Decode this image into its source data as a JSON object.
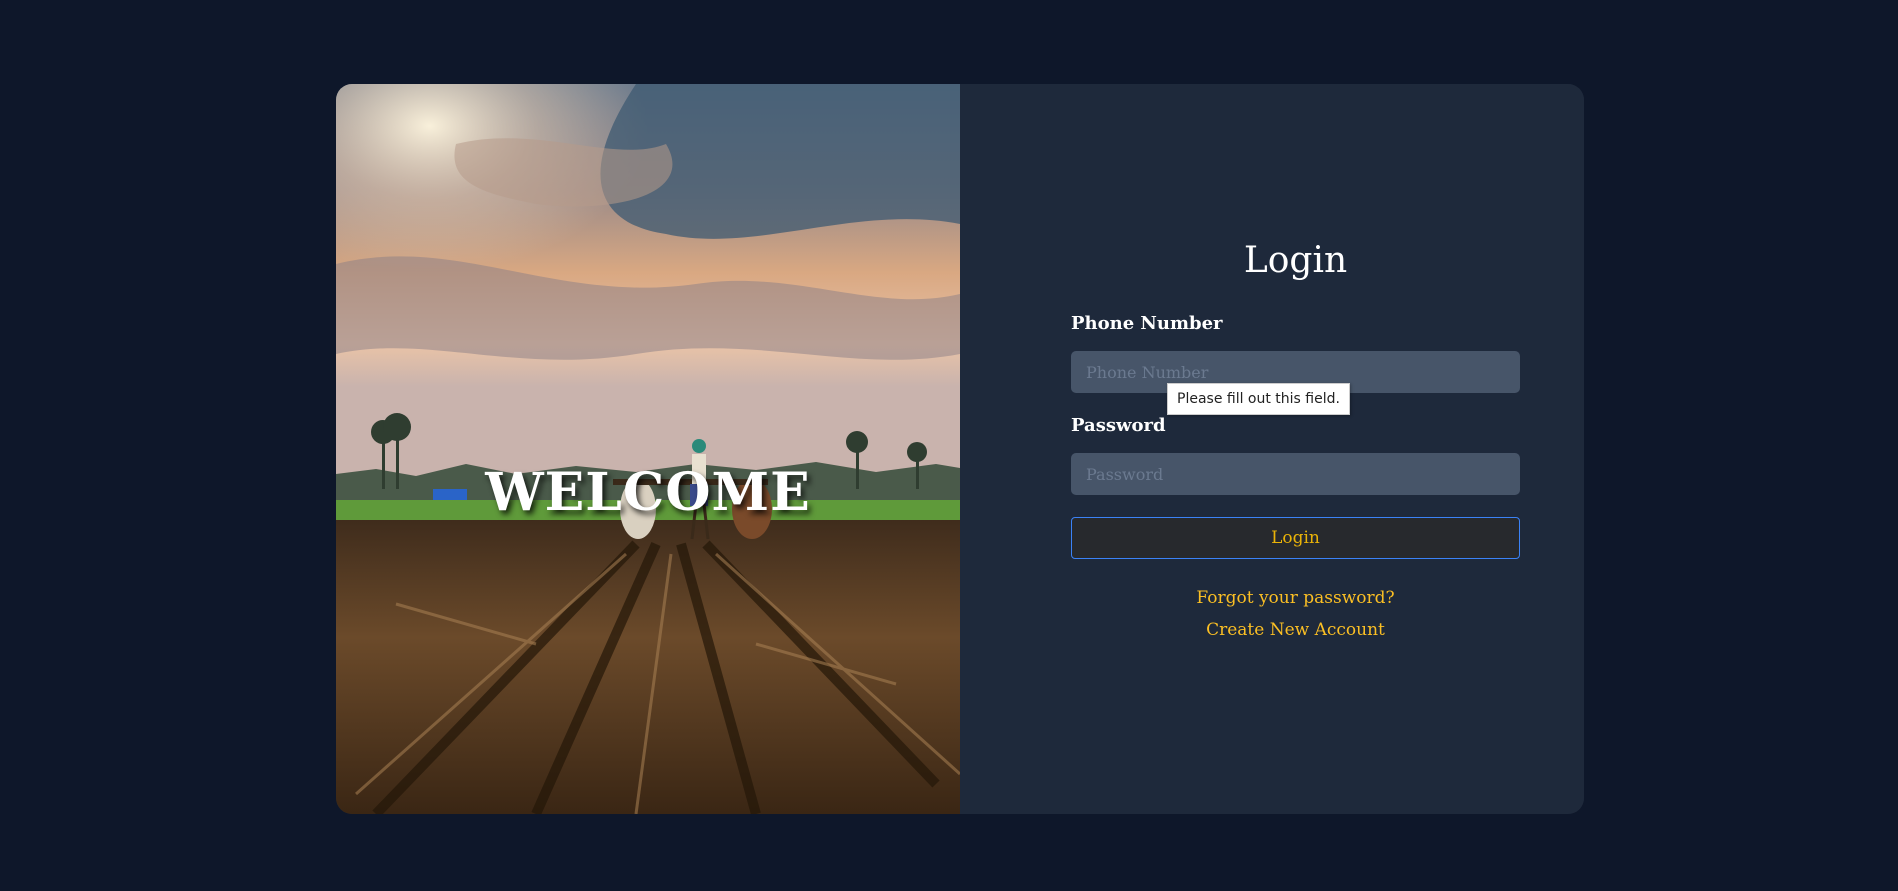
{
  "hero": {
    "welcome_text": "WELCOME",
    "image": "farmer-ploughing-field-with-oxen-image"
  },
  "login": {
    "title": "Login",
    "phone_label": "Phone Number",
    "phone_placeholder": "Phone Number",
    "phone_value": "",
    "password_label": "Password",
    "password_placeholder": "Password",
    "password_value": "",
    "submit_label": "Login",
    "forgot_link": "Forgot your password?",
    "create_link": "Create New Account"
  },
  "validation": {
    "tooltip": "Please fill out this field."
  },
  "colors": {
    "page_bg": "#0e172a",
    "panel_bg": "#1e293b",
    "input_bg": "#475569",
    "link": "#fbbf24",
    "button_border": "#3b82f6"
  }
}
